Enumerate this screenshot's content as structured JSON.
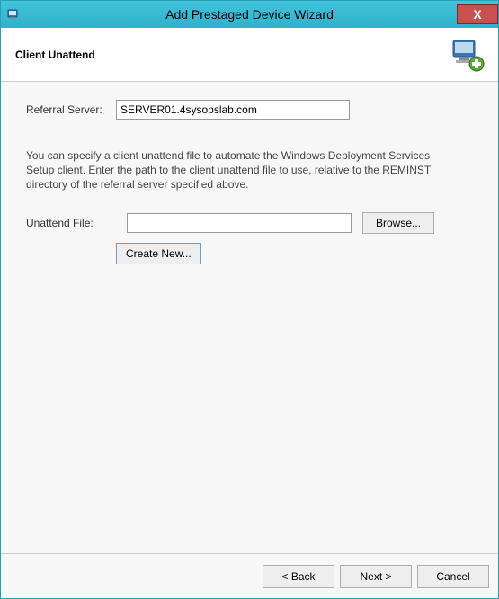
{
  "window": {
    "title": "Add Prestaged Device Wizard",
    "close_glyph": "X"
  },
  "header": {
    "step_title": "Client Unattend"
  },
  "form": {
    "referral_label": "Referral Server:",
    "referral_value": "SERVER01.4sysopslab.com",
    "info_text": "You can specify a client unattend file to automate the Windows Deployment Services Setup client. Enter the path to the client unattend file to use, relative to the REMINST directory of the referral server specified above.",
    "unattend_label": "Unattend File:",
    "unattend_value": "",
    "browse_label": "Browse...",
    "create_new_label": "Create New..."
  },
  "footer": {
    "back_label": "< Back",
    "next_label": "Next >",
    "cancel_label": "Cancel"
  }
}
